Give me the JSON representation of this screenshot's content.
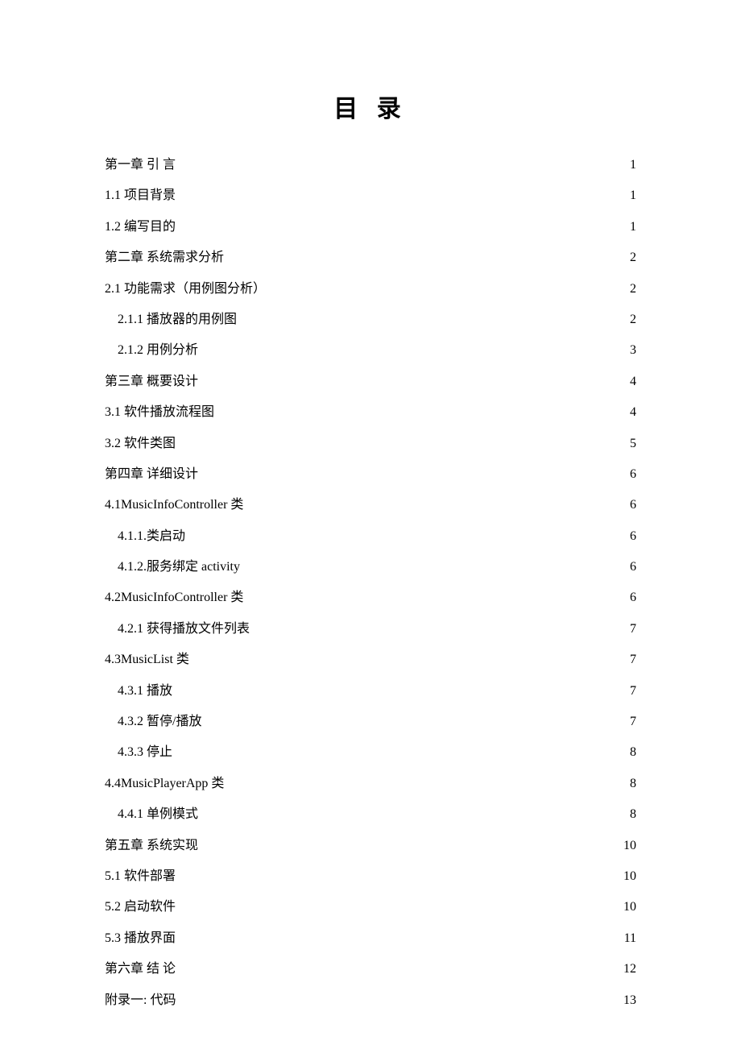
{
  "title": "目 录",
  "entries": [
    {
      "label": "第一章 引 言",
      "page": "1",
      "level": 1
    },
    {
      "label": "1.1 项目背景",
      "page": "1",
      "level": 2
    },
    {
      "label": "1.2 编写目的",
      "page": "1",
      "level": 2
    },
    {
      "label": "第二章 系统需求分析",
      "page": "2",
      "level": 1
    },
    {
      "label": "2.1 功能需求（用例图分析）",
      "page": "2",
      "level": 2
    },
    {
      "label": "2.1.1 播放器的用例图",
      "page": "2",
      "level": 3
    },
    {
      "label": "2.1.2 用例分析 ",
      "page": "3",
      "level": 3
    },
    {
      "label": "第三章 概要设计",
      "page": "4",
      "level": 1
    },
    {
      "label": "3.1 软件播放流程图 ",
      "page": "4",
      "level": 2
    },
    {
      "label": "3.2 软件类图",
      "page": "5",
      "level": 2
    },
    {
      "label": "第四章 详细设计",
      "page": "6",
      "level": 1
    },
    {
      "label": "4.1MusicInfoController 类 ",
      "page": "6",
      "level": 2
    },
    {
      "label": "4.1.1.类启动",
      "page": "6",
      "level": 3
    },
    {
      "label": "4.1.2.服务绑定 activity ",
      "page": "6",
      "level": 3
    },
    {
      "label": "4.2MusicInfoController 类 ",
      "page": "6",
      "level": 2
    },
    {
      "label": "4.2.1 获得播放文件列表 ",
      "page": "7",
      "level": 3
    },
    {
      "label": "4.3MusicList 类 ",
      "page": "7",
      "level": 2
    },
    {
      "label": "4.3.1 播放 ",
      "page": "7",
      "level": 3
    },
    {
      "label": "4.3.2 暂停/播放 ",
      "page": "7",
      "level": 3
    },
    {
      "label": "4.3.3 停止 ",
      "page": "8",
      "level": 3
    },
    {
      "label": "4.4MusicPlayerApp 类 ",
      "page": "8",
      "level": 2
    },
    {
      "label": "4.4.1 单例模式 ",
      "page": "8",
      "level": 3
    },
    {
      "label": "第五章 系统实现",
      "page": "10",
      "level": 1
    },
    {
      "label": "5.1 软件部署 ",
      "page": "10",
      "level": 2
    },
    {
      "label": "5.2 启动软件 ",
      "page": "10",
      "level": 2
    },
    {
      "label": "5.3 播放界面 ",
      "page": "11",
      "level": 2
    },
    {
      "label": "第六章 结 论",
      "page": "12",
      "level": 1
    },
    {
      "label": "附录一:  代码",
      "page": "13",
      "level": 1
    }
  ]
}
